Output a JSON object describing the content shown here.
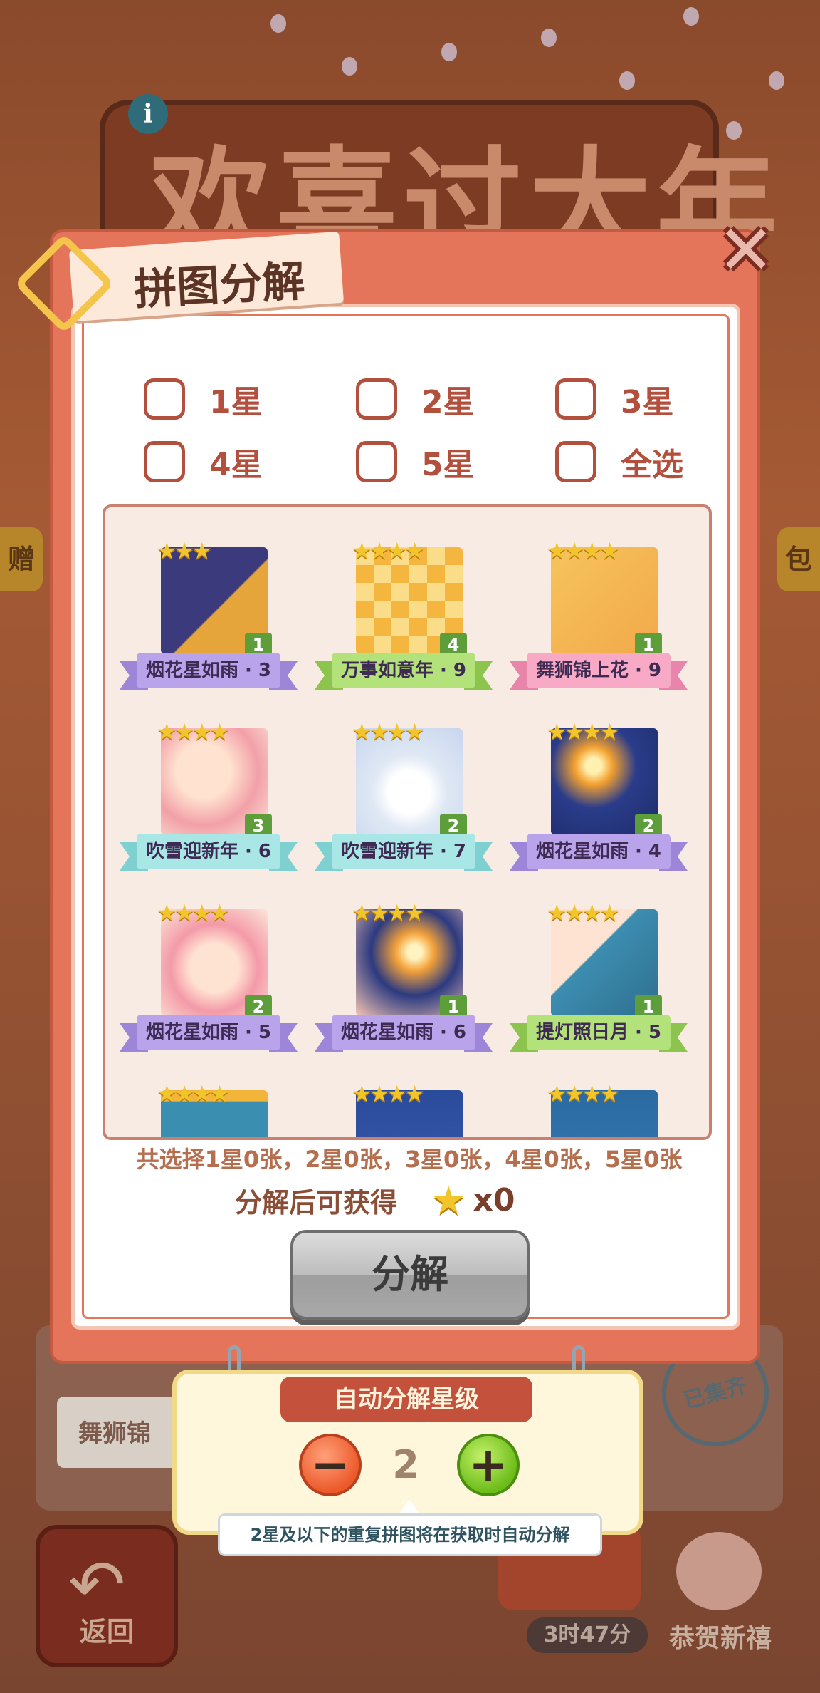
{
  "background": {
    "title": "欢喜过大年",
    "side_left": "赠",
    "side_right": "包",
    "card_label": "舞狮锦",
    "stamp": "已集齐",
    "back_label": "返回",
    "timer": "3时47分",
    "newyear_label": "恭贺新禧"
  },
  "dialog": {
    "title": "拼图分解",
    "close_icon": "close-icon",
    "filters": [
      {
        "label": "1星"
      },
      {
        "label": "2星"
      },
      {
        "label": "3星"
      },
      {
        "label": "4星"
      },
      {
        "label": "5星"
      },
      {
        "label": "全选"
      }
    ],
    "pieces": [
      {
        "name": "烟花星如雨 · 3",
        "stars": "★★★",
        "count": "1",
        "ribbon": "purple"
      },
      {
        "name": "万事如意年 · 9",
        "stars": "★★★★",
        "count": "4",
        "ribbon": "green"
      },
      {
        "name": "舞狮锦上花 · 9",
        "stars": "★★★★",
        "count": "1",
        "ribbon": "pink"
      },
      {
        "name": "吹雪迎新年 · 6",
        "stars": "★★★★",
        "count": "3",
        "ribbon": "cyan"
      },
      {
        "name": "吹雪迎新年 · 7",
        "stars": "★★★★",
        "count": "2",
        "ribbon": "cyan"
      },
      {
        "name": "烟花星如雨 · 4",
        "stars": "★★★★",
        "count": "2",
        "ribbon": "purple"
      },
      {
        "name": "烟花星如雨 · 5",
        "stars": "★★★★",
        "count": "2",
        "ribbon": "purple"
      },
      {
        "name": "烟花星如雨 · 6",
        "stars": "★★★★",
        "count": "1",
        "ribbon": "purple"
      },
      {
        "name": "提灯照日月 · 5",
        "stars": "★★★★",
        "count": "1",
        "ribbon": "green"
      },
      {
        "name": "",
        "stars": "★★★★",
        "count": "",
        "ribbon": "none"
      },
      {
        "name": "",
        "stars": "★★★★",
        "count": "",
        "ribbon": "none"
      },
      {
        "name": "",
        "stars": "★★★★",
        "count": "",
        "ribbon": "none"
      }
    ],
    "summary": "共选择1星0张，2星0张，3星0张，4星0张，5星0张",
    "gain_text": "分解后可获得",
    "gain_icon": "star-icon",
    "gain_count": "x0",
    "decompose_label": "分解"
  },
  "auto_decompose": {
    "title": "自动分解星级",
    "value": "2",
    "minus": "−",
    "plus": "+",
    "tooltip": "2星及以下的重复拼图将在获取时自动分解"
  },
  "colors": {
    "modal": "#e4745a",
    "ribbon_purple": "#b9a4ec",
    "ribbon_green": "#b4e27a",
    "ribbon_pink": "#f7a9c6",
    "ribbon_cyan": "#a9e6e6"
  }
}
